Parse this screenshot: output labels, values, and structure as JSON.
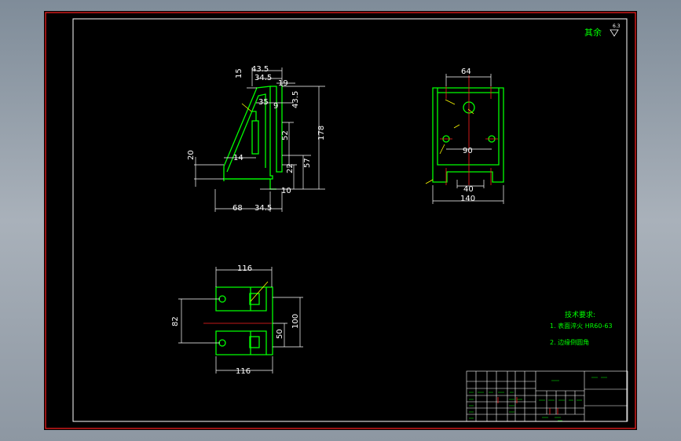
{
  "surface_finish": {
    "label": "其余",
    "value": "6.3"
  },
  "views": {
    "front": {
      "dims": {
        "d43_5_top": "43.5",
        "d34_5_top": "34.5",
        "d15": "15",
        "d19": "19",
        "d35": "35",
        "d9": "9",
        "d43_5_right": "43.5",
        "d52": "52",
        "d178": "178",
        "d14": "14",
        "d22": "22",
        "d57": "57",
        "d20": "20",
        "d10": "10",
        "d68": "68",
        "d34_5_bottom": "34.5"
      }
    },
    "side": {
      "dims": {
        "d64": "64",
        "d90": "90",
        "d40": "40",
        "d140": "140"
      }
    },
    "top": {
      "dims": {
        "d116_top": "116",
        "d82": "82",
        "d100": "100",
        "d50": "50",
        "d116_bottom": "116"
      }
    }
  },
  "notes": {
    "title": "技术要求:",
    "line1": "1. 表面淬火 HR60-63",
    "line2": "2. 边缘倒圆角"
  },
  "colors": {
    "outline": "#00ff00",
    "dimension": "#ffffff",
    "leader": "#ffff00",
    "center": "#ff0000",
    "frame": "#ff0000",
    "border": "#ffffff"
  }
}
